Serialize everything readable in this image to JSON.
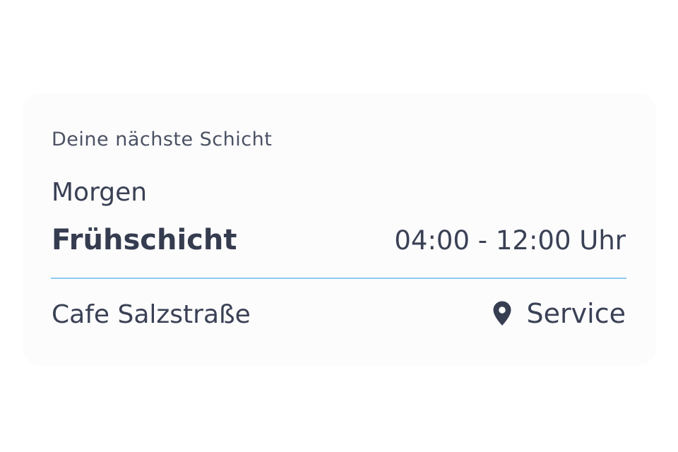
{
  "card": {
    "heading": "Deine nächste Schicht",
    "day": "Morgen",
    "shift_name": "Frühschicht",
    "shift_time": "04:00 - 12:00 Uhr",
    "location": "Cafe Salzstraße",
    "role": "Service",
    "role_icon": "map-pin-icon"
  },
  "colors": {
    "card_background": "#fcfcfd",
    "text": "#373e52",
    "divider": "#8ecbee"
  }
}
